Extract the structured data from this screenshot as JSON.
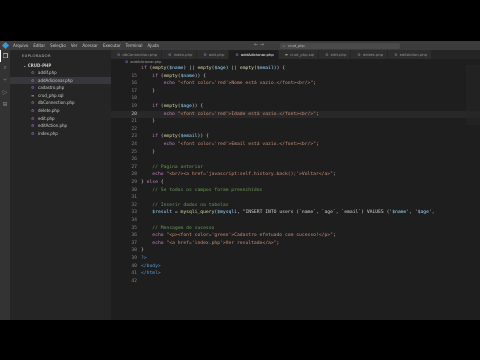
{
  "window": {
    "menu": [
      "Arquivo",
      "Editar",
      "Seleção",
      "Ver",
      "Acessar",
      "Executar",
      "Terminal",
      "Ajuda"
    ],
    "nav_arrows": "← →",
    "search_placeholder": "crud_php"
  },
  "activity_bar": [
    "explorer-icon",
    "search-icon",
    "source-control-icon",
    "run-debug-icon",
    "extensions-icon"
  ],
  "sidebar": {
    "header": "EXPLORADOR",
    "folder": "CRUD-PHP",
    "files": [
      {
        "name": "addif.php",
        "selected": false
      },
      {
        "name": "addAdicionar.php",
        "selected": true
      },
      {
        "name": "cadastro.php",
        "selected": false
      },
      {
        "name": "crud_php.sql",
        "selected": false
      },
      {
        "name": "dbConnection.php",
        "selected": false
      },
      {
        "name": "delete.php",
        "selected": false
      },
      {
        "name": "edit.php",
        "selected": false
      },
      {
        "name": "editAction.php",
        "selected": false
      },
      {
        "name": "index.php",
        "selected": false
      }
    ]
  },
  "tabs": [
    {
      "label": "dbConnection.php",
      "active": false
    },
    {
      "label": "index.php",
      "active": false
    },
    {
      "label": "add.php",
      "active": false
    },
    {
      "label": "addAdicionar.php",
      "active": true
    },
    {
      "label": "crud_php.sql",
      "active": false
    },
    {
      "label": "edit.php",
      "active": false
    },
    {
      "label": "delete.php",
      "active": false
    },
    {
      "label": "editAction.php",
      "active": false
    }
  ],
  "breadcrumb": "addAdicionar.php",
  "editor": {
    "current_line": 20,
    "lines": [
      {
        "n": "",
        "code": "if (empty($name) || empty($age) || empty($email)) {"
      },
      {
        "n": "15",
        "code": "    if (empty($name)) {"
      },
      {
        "n": "16",
        "code": "        echo \"<font color='red'>Nome está vazio.</font><br/>\";"
      },
      {
        "n": "17",
        "code": "    }"
      },
      {
        "n": "18",
        "code": ""
      },
      {
        "n": "19",
        "code": "    if (empty($age)) {"
      },
      {
        "n": "20",
        "code": "        echo \"<font color='red'>Idade está vazio.</font><br/>\";"
      },
      {
        "n": "21",
        "code": "    }"
      },
      {
        "n": "22",
        "code": ""
      },
      {
        "n": "23",
        "code": "    if (empty($email)) {"
      },
      {
        "n": "24",
        "code": "        echo \"<font color='red'>Email está vazio.</font><br/>\";"
      },
      {
        "n": "25",
        "code": "    }"
      },
      {
        "n": "26",
        "code": ""
      },
      {
        "n": "27",
        "code": "    // Pagina anterior"
      },
      {
        "n": "28",
        "code": "    echo \"<br/><a href='javascript:self.history.back();'>Voltar</a>\";"
      },
      {
        "n": "29",
        "code": "} else {"
      },
      {
        "n": "30",
        "code": "    // Se todos os campos foram preenchidos"
      },
      {
        "n": "31",
        "code": ""
      },
      {
        "n": "32",
        "code": "    // Inserir dados na tabelas"
      },
      {
        "n": "33",
        "code": "    $result = mysqli_query($mysqli, \"INSERT INTO users (`name`, `age`, `email`) VALUES ('$name', '$age',"
      },
      {
        "n": "34",
        "code": ""
      },
      {
        "n": "35",
        "code": "    // Mensagem de sucesso"
      },
      {
        "n": "36",
        "code": "    echo \"<p><font color='green'>Cadastro efetuado com sucesso!</p>\";"
      },
      {
        "n": "37",
        "code": "    echo \"<a href='index.php'>Ver resultado</a>\";"
      },
      {
        "n": "38",
        "code": "}"
      },
      {
        "n": "39",
        "code": "?>"
      },
      {
        "n": "40",
        "code": "</body>"
      },
      {
        "n": "41",
        "code": "</html>"
      },
      {
        "n": "42",
        "code": ""
      }
    ]
  },
  "colors": {
    "editor_bg": "#1e1e1e",
    "sidebar_bg": "#252526",
    "activity_bg": "#333333",
    "keyword": "#c586c0",
    "variable": "#9cdcfe",
    "function": "#dcdcaa",
    "string": "#ce9178",
    "comment": "#6a9955"
  }
}
